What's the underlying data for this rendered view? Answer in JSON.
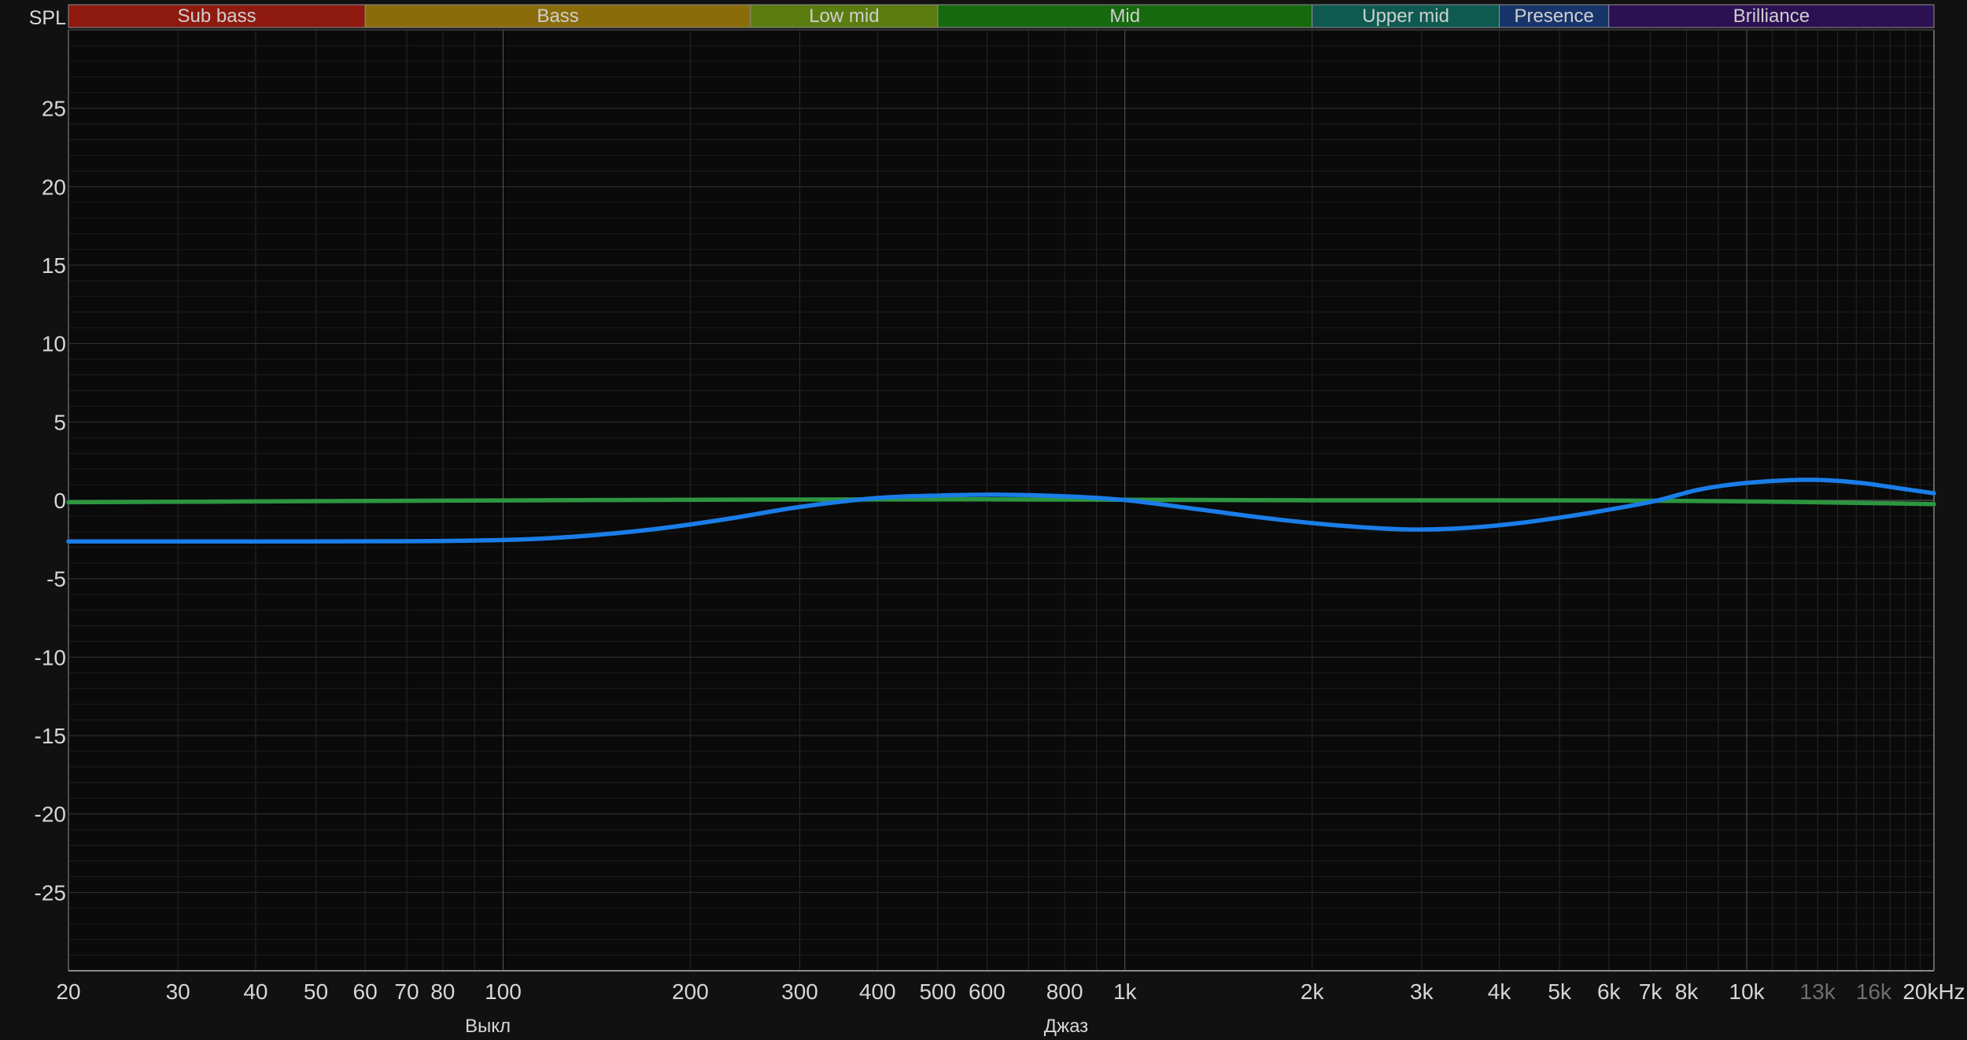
{
  "header": {
    "spl_label": "SPL",
    "bands": [
      {
        "key": "sub-bass",
        "label": "Sub bass",
        "from_hz": 20,
        "to_hz": 60,
        "color": "#8e1a10"
      },
      {
        "key": "bass",
        "label": "Bass",
        "from_hz": 60,
        "to_hz": 250,
        "color": "#8a6d0a"
      },
      {
        "key": "low-mid",
        "label": "Low mid",
        "from_hz": 250,
        "to_hz": 500,
        "color": "#5b7c0f"
      },
      {
        "key": "mid",
        "label": "Mid",
        "from_hz": 500,
        "to_hz": 2000,
        "color": "#17690f"
      },
      {
        "key": "upper-mid",
        "label": "Upper mid",
        "from_hz": 2000,
        "to_hz": 4000,
        "color": "#0e5a50"
      },
      {
        "key": "presence",
        "label": "Presence",
        "from_hz": 4000,
        "to_hz": 6000,
        "color": "#17356b"
      },
      {
        "key": "brilliance",
        "label": "Brilliance",
        "from_hz": 6000,
        "to_hz": 20000,
        "color": "#2c1152"
      }
    ]
  },
  "legend": [
    {
      "key": "off",
      "label": "Выкл",
      "color": "#2fa044"
    },
    {
      "key": "jazz",
      "label": "Джаз",
      "color": "#2589ec"
    }
  ],
  "chart_data": {
    "type": "line",
    "ylabel": "SPL",
    "x_scale": "log",
    "xlim": [
      20,
      20000
    ],
    "ylim": [
      -30,
      30
    ],
    "grid": true,
    "y_ticks": [
      25,
      20,
      15,
      10,
      5,
      0,
      -5,
      -10,
      -15,
      -20,
      -25
    ],
    "x_ticks": [
      {
        "f": 20,
        "label": "20"
      },
      {
        "f": 30,
        "label": "30"
      },
      {
        "f": 40,
        "label": "40"
      },
      {
        "f": 50,
        "label": "50"
      },
      {
        "f": 60,
        "label": "60"
      },
      {
        "f": 70,
        "label": "70"
      },
      {
        "f": 80,
        "label": "80"
      },
      {
        "f": 100,
        "label": "100"
      },
      {
        "f": 200,
        "label": "200"
      },
      {
        "f": 300,
        "label": "300"
      },
      {
        "f": 400,
        "label": "400"
      },
      {
        "f": 500,
        "label": "500"
      },
      {
        "f": 600,
        "label": "600"
      },
      {
        "f": 800,
        "label": "800"
      },
      {
        "f": 1000,
        "label": "1k"
      },
      {
        "f": 2000,
        "label": "2k"
      },
      {
        "f": 3000,
        "label": "3k"
      },
      {
        "f": 4000,
        "label": "4k"
      },
      {
        "f": 5000,
        "label": "5k"
      },
      {
        "f": 6000,
        "label": "6k"
      },
      {
        "f": 7000,
        "label": "7k"
      },
      {
        "f": 8000,
        "label": "8k"
      },
      {
        "f": 10000,
        "label": "10k"
      },
      {
        "f": 13000,
        "label": "13k",
        "dim": true
      },
      {
        "f": 16000,
        "label": "16k",
        "dim": true
      },
      {
        "f": 20000,
        "label": "20kHz"
      }
    ],
    "minor_gridline_freqs": [
      30,
      40,
      50,
      60,
      70,
      80,
      90,
      100,
      200,
      300,
      400,
      500,
      600,
      700,
      800,
      900,
      1000,
      2000,
      3000,
      4000,
      5000,
      6000,
      7000,
      8000,
      9000,
      10000,
      11000,
      12000,
      13000,
      14000,
      15000,
      16000,
      17000,
      18000,
      19000
    ],
    "decade_freqs": [
      100,
      1000,
      10000
    ],
    "series": [
      {
        "key": "off",
        "name": "Выкл",
        "color": "#2c9640",
        "points": [
          [
            20,
            -0.12
          ],
          [
            40,
            -0.07
          ],
          [
            80,
            -0.02
          ],
          [
            150,
            0.02
          ],
          [
            300,
            0.05
          ],
          [
            600,
            0.06
          ],
          [
            1000,
            0.04
          ],
          [
            1600,
            0.01
          ],
          [
            2500,
            0
          ],
          [
            4000,
            0
          ],
          [
            6000,
            -0.01
          ],
          [
            8000,
            -0.04
          ],
          [
            10000,
            -0.07
          ],
          [
            12500,
            -0.11
          ],
          [
            15000,
            -0.16
          ],
          [
            17500,
            -0.2
          ],
          [
            20000,
            -0.24
          ]
        ]
      },
      {
        "key": "jazz",
        "name": "Джаз",
        "color": "#1a7de8",
        "points": [
          [
            20,
            -2.62
          ],
          [
            30,
            -2.62
          ],
          [
            45,
            -2.62
          ],
          [
            65,
            -2.61
          ],
          [
            85,
            -2.58
          ],
          [
            110,
            -2.48
          ],
          [
            140,
            -2.22
          ],
          [
            180,
            -1.78
          ],
          [
            230,
            -1.18
          ],
          [
            300,
            -0.42
          ],
          [
            400,
            0.15
          ],
          [
            500,
            0.3
          ],
          [
            630,
            0.36
          ],
          [
            800,
            0.26
          ],
          [
            1000,
            0.02
          ],
          [
            1300,
            -0.55
          ],
          [
            1700,
            -1.15
          ],
          [
            2200,
            -1.6
          ],
          [
            2800,
            -1.85
          ],
          [
            3400,
            -1.8
          ],
          [
            4200,
            -1.5
          ],
          [
            5200,
            -1.0
          ],
          [
            6300,
            -0.45
          ],
          [
            7200,
            0.0
          ],
          [
            8200,
            0.6
          ],
          [
            9200,
            0.95
          ],
          [
            10500,
            1.18
          ],
          [
            12000,
            1.3
          ],
          [
            13500,
            1.28
          ],
          [
            15500,
            1.08
          ],
          [
            17500,
            0.78
          ],
          [
            20000,
            0.45
          ]
        ]
      }
    ]
  }
}
